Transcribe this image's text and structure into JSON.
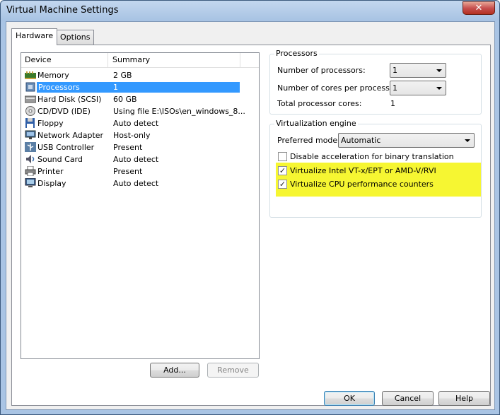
{
  "window": {
    "title": "Virtual Machine Settings",
    "close_glyph": "✕"
  },
  "tabs": [
    {
      "label": "Hardware",
      "active": true
    },
    {
      "label": "Options",
      "active": false
    }
  ],
  "device_list": {
    "columns": [
      "Device",
      "Summary"
    ],
    "rows": [
      {
        "device": "Memory",
        "summary": "2 GB",
        "icon": "memory-icon"
      },
      {
        "device": "Processors",
        "summary": "1",
        "icon": "processor-icon",
        "selected": true
      },
      {
        "device": "Hard Disk (SCSI)",
        "summary": "60 GB",
        "icon": "hard-disk-icon"
      },
      {
        "device": "CD/DVD (IDE)",
        "summary": "Using file E:\\ISOs\\en_windows_8...",
        "icon": "cd-dvd-icon"
      },
      {
        "device": "Floppy",
        "summary": "Auto detect",
        "icon": "floppy-icon"
      },
      {
        "device": "Network Adapter",
        "summary": "Host-only",
        "icon": "network-adapter-icon"
      },
      {
        "device": "USB Controller",
        "summary": "Present",
        "icon": "usb-icon"
      },
      {
        "device": "Sound Card",
        "summary": "Auto detect",
        "icon": "sound-card-icon"
      },
      {
        "device": "Printer",
        "summary": "Present",
        "icon": "printer-icon"
      },
      {
        "device": "Display",
        "summary": "Auto detect",
        "icon": "display-icon"
      }
    ],
    "add_label": "Add...",
    "remove_label": "Remove"
  },
  "processors": {
    "group_title": "Processors",
    "num_processors_label": "Number of processors:",
    "num_processors_value": "1",
    "cores_label": "Number of cores per processor:",
    "cores_value": "1",
    "total_label": "Total processor cores:",
    "total_value": "1"
  },
  "virtualization": {
    "group_title": "Virtualization engine",
    "mode_label": "Preferred mode:",
    "mode_value": "Automatic",
    "disable_accel_label": "Disable acceleration for binary translation",
    "disable_accel_checked": false,
    "vtx_label": "Virtualize Intel VT-x/EPT or AMD-V/RVI",
    "vtx_checked": true,
    "cpu_counters_label": "Virtualize CPU performance counters",
    "cpu_counters_checked": true,
    "check_glyph": "✓",
    "highlight_color": "#f6f632"
  },
  "footer": {
    "ok_label": "OK",
    "cancel_label": "Cancel",
    "help_label": "Help"
  },
  "colors": {
    "selection": "#3399ff",
    "title_bar": "#a9c4e4"
  }
}
